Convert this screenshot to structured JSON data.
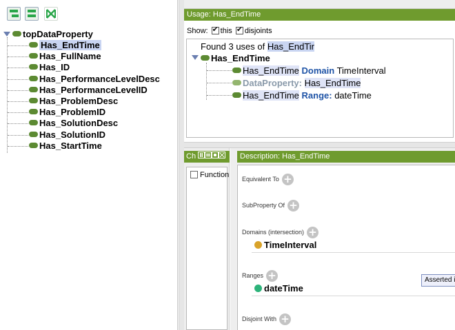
{
  "left": {
    "tree_root": "topDataProperty",
    "items": [
      "Has_EndTime",
      "Has_FullName",
      "Has_ID",
      "Has_PerformanceLevelDesc",
      "Has_PerformanceLevelID",
      "Has_ProblemDesc",
      "Has_ProblemID",
      "Has_SolutionDesc",
      "Has_SolutionID",
      "Has_StartTime"
    ]
  },
  "usage": {
    "header": "Usage: Has_EndTime",
    "show_label": "Show:",
    "this_label": "this",
    "disjoints_label": "disjoints",
    "found_prefix": "Found 3 uses of ",
    "found_target": "Has_EndTir",
    "root": "Has_EndTime",
    "entries": [
      {
        "subject": "Has_EndTime",
        "keyword": "Domain",
        "object": "TimeInterval"
      },
      {
        "subject": "",
        "keyword": "DataProperty:",
        "object": "Has_EndTime"
      },
      {
        "subject": "Has_EndTime",
        "keyword": "Range:",
        "object": "dateTime"
      }
    ]
  },
  "characteristics": {
    "header": "Ch",
    "functional_label": "Function"
  },
  "description": {
    "header": "Description: Has_EndTime",
    "equivalent_to": "Equivalent To",
    "subproperty_of": "SubProperty Of",
    "domains": "Domains (intersection)",
    "domain_value": "TimeInterval",
    "ranges": "Ranges",
    "range_value": "dateTime",
    "disjoint_with": "Disjoint With",
    "tooltip": "Asserted i"
  },
  "colors": {
    "header_green": "#6f9b2e",
    "property_dot": "#5c8a32",
    "class_dot": "#d9a32a",
    "datatype_dot": "#2db37a",
    "keyword_blue": "#1e53a6",
    "selection": "#c9d5f2"
  }
}
